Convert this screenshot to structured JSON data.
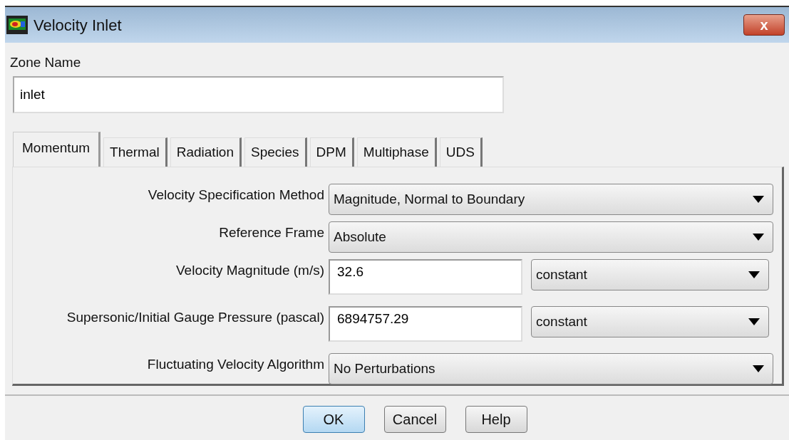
{
  "window": {
    "title": "Velocity Inlet",
    "close": "x"
  },
  "zone_name": {
    "label": "Zone Name",
    "value": "inlet"
  },
  "tabs": [
    {
      "label": "Momentum",
      "selected": true
    },
    {
      "label": "Thermal",
      "selected": false
    },
    {
      "label": "Radiation",
      "selected": false
    },
    {
      "label": "Species",
      "selected": false
    },
    {
      "label": "DPM",
      "selected": false
    },
    {
      "label": "Multiphase",
      "selected": false
    },
    {
      "label": "UDS",
      "selected": false
    }
  ],
  "fields": [
    {
      "kind": "select",
      "label": "Velocity Specification Method",
      "value": "Magnitude, Normal to Boundary"
    },
    {
      "kind": "select",
      "label": "Reference Frame",
      "value": "Absolute"
    },
    {
      "kind": "input",
      "label": "Velocity Magnitude (m/s)",
      "value": "32.6",
      "profile": "constant"
    },
    {
      "kind": "input",
      "label": "Supersonic/Initial Gauge Pressure (pascal)",
      "value": "6894757.29",
      "profile": "constant"
    },
    {
      "kind": "select",
      "label": "Fluctuating Velocity Algorithm",
      "value": "No Perturbations"
    }
  ],
  "buttons": [
    {
      "label": "OK",
      "default": true
    },
    {
      "label": "Cancel",
      "default": false
    },
    {
      "label": "Help",
      "default": false
    }
  ]
}
